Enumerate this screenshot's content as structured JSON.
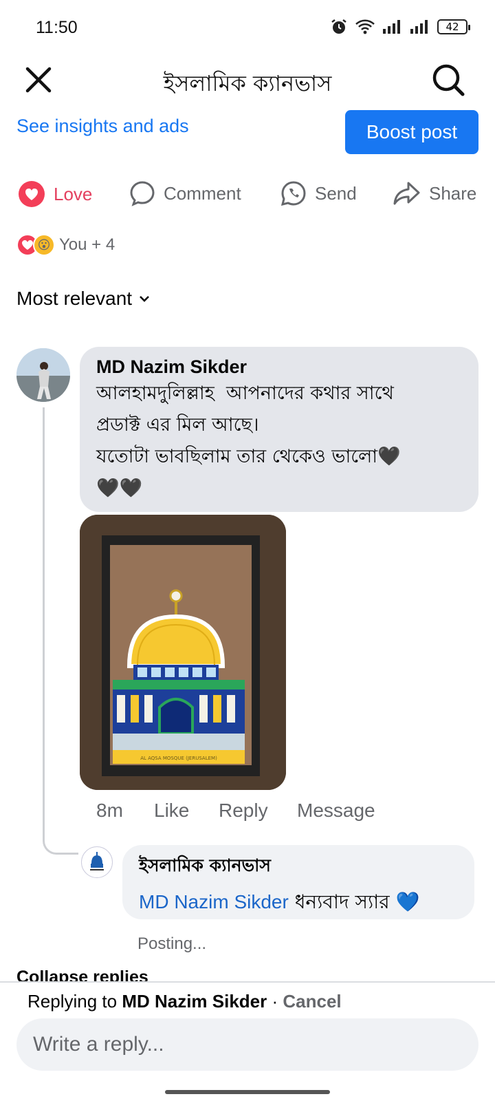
{
  "status": {
    "time": "11:50",
    "battery": "42"
  },
  "header": {
    "title": "ইসলামিক ক্যানভাস"
  },
  "top_actions": {
    "insights": "See insights and ads",
    "boost": "Boost post"
  },
  "actions": {
    "love": "Love",
    "comment": "Comment",
    "send": "Send",
    "share": "Share"
  },
  "reactions": {
    "summary": "You + 4"
  },
  "sort": {
    "label": "Most relevant"
  },
  "comment": {
    "author": "MD Nazim Sikder",
    "text": "আলহামদুলিল্লাহ  আপনাদের কথার সাথে\nপ্রডাক্ট এর মিল আছে।\nযতোটা ভাবছিলাম তার থেকেও ভালো🖤\n🖤🖤",
    "photo_caption": "AL AQSA MOSQUE (JERUSALEM)",
    "time": "8m",
    "like": "Like",
    "reply": "Reply",
    "message": "Message"
  },
  "reply": {
    "author": "ইসলামিক ক্যানভাস",
    "mention": "MD Nazim Sikder",
    "text": " ধন্যবাদ স্যার 💙",
    "status": "Posting..."
  },
  "collapse": "Collapse replies",
  "composer": {
    "replying_prefix": "Replying to ",
    "replying_name": "MD Nazim Sikder",
    "separator": " · ",
    "cancel": "Cancel",
    "placeholder": "Write a reply..."
  },
  "colors": {
    "accent": "#1877f2",
    "love": "#e4405f",
    "bubble": "#e4e6eb"
  }
}
